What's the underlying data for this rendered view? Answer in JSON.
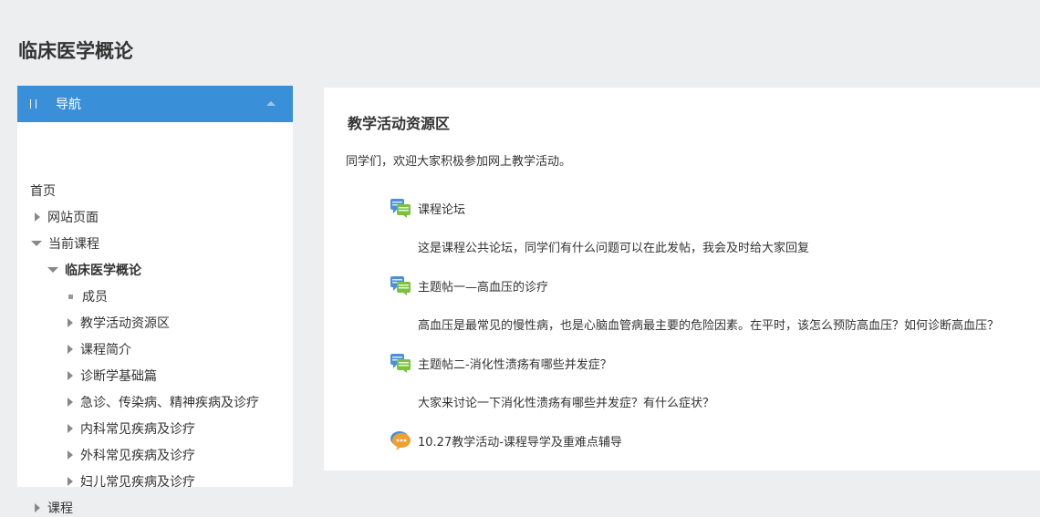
{
  "course": {
    "title": "临床医学概论"
  },
  "nav": {
    "header": "导航",
    "items": [
      {
        "label": "首页",
        "marker": "none",
        "bold": false
      },
      {
        "label": "网站页面",
        "marker": "arrow-right",
        "bold": false
      },
      {
        "label": "当前课程",
        "marker": "arrow-down",
        "bold": false
      },
      {
        "label": "临床医学概论",
        "marker": "arrow-down",
        "bold": true
      },
      {
        "label": "成员",
        "marker": "square",
        "bold": false
      },
      {
        "label": "教学活动资源区",
        "marker": "arrow-right",
        "bold": false
      },
      {
        "label": "课程简介",
        "marker": "arrow-right",
        "bold": false
      },
      {
        "label": "诊断学基础篇",
        "marker": "arrow-right",
        "bold": false
      },
      {
        "label": "急诊、传染病、精神疾病及诊疗",
        "marker": "arrow-right",
        "bold": false
      },
      {
        "label": "内科常见疾病及诊疗",
        "marker": "arrow-right",
        "bold": false
      },
      {
        "label": "外科常见疾病及诊疗",
        "marker": "arrow-right",
        "bold": false
      },
      {
        "label": "妇儿常见疾病及诊疗",
        "marker": "arrow-right",
        "bold": false
      },
      {
        "label": "课程",
        "marker": "arrow-right",
        "bold": false
      }
    ]
  },
  "main": {
    "heading": "教学活动资源区",
    "summary": "同学们，欢迎大家积极参加网上教学活动。",
    "activities": [
      {
        "title": "课程论坛",
        "description": "这是课程公共论坛，同学们有什么问题可以在此发帖，我会及时给大家回复",
        "icon": "forum-icon"
      },
      {
        "title": "主题帖一—高血压的诊疗",
        "description": "高血压是最常见的慢性病，也是心脑血管病最主要的危险因素。在平时，该怎么预防高血压？如何诊断高血压？",
        "icon": "forum-icon"
      },
      {
        "title": "主题帖二-消化性溃疡有哪些并发症？",
        "description": "大家来讨论一下消化性溃疡有哪些并发症？有什么症状？",
        "icon": "forum-icon"
      },
      {
        "title": "10.27教学活动-课程导学及重难点辅导",
        "description": "",
        "icon": "chat-icon"
      }
    ]
  },
  "colors": {
    "nav_header": "#3a8fd9",
    "page_bg": "#eceeef",
    "forum_blue": "#4a8fd8",
    "forum_green": "#7cc242",
    "chat_orange": "#f0a030"
  }
}
